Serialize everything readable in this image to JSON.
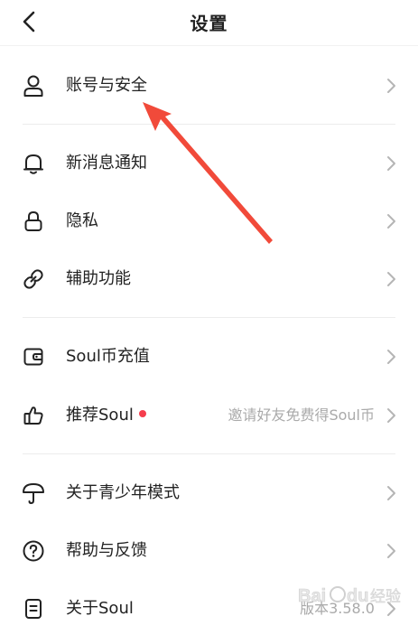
{
  "header": {
    "title": "设置",
    "back_icon": "chevron-left-icon"
  },
  "rows": [
    {
      "label": "账号与安全",
      "icon": "user-icon"
    },
    {
      "label": "新消息通知",
      "icon": "bell-icon"
    },
    {
      "label": "隐私",
      "icon": "lock-icon"
    },
    {
      "label": "辅助功能",
      "icon": "link-icon"
    },
    {
      "label": "Soul币充值",
      "icon": "wallet-icon"
    },
    {
      "label": "推荐Soul",
      "icon": "thumbs-up-icon",
      "hint": "邀请好友免费得Soul币",
      "has_badge": true
    },
    {
      "label": "关于青少年模式",
      "icon": "umbrella-icon"
    },
    {
      "label": "帮助与反馈",
      "icon": "question-circle-icon"
    },
    {
      "label": "关于Soul",
      "icon": "document-icon",
      "hint": "版本3.58.0"
    }
  ],
  "watermark": {
    "text": "Baidu 经验"
  },
  "colors": {
    "accent_red": "#f53d4d",
    "text": "#222222",
    "hint": "#aaaaaa",
    "divider": "#ececec"
  }
}
